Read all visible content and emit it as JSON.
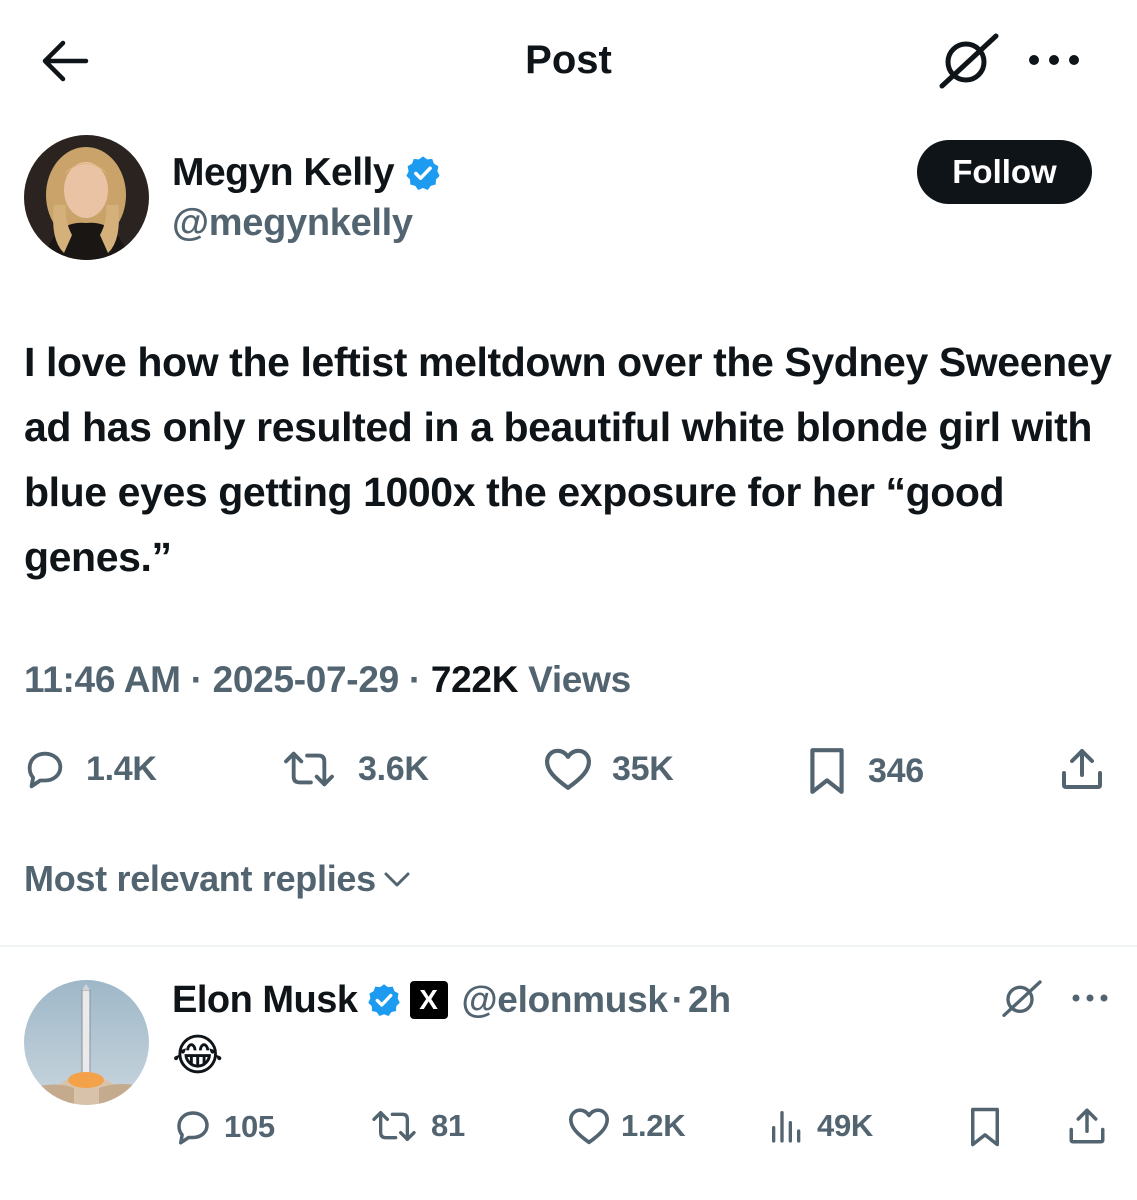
{
  "header": {
    "title": "Post",
    "icons": {
      "back": "arrow-left-icon",
      "grok": "grok-icon",
      "more": "more-horizontal-icon"
    }
  },
  "post": {
    "author": {
      "name": "Megyn Kelly",
      "handle": "@megynkelly",
      "verified_badge_color": "#1d9bf0"
    },
    "follow_label": "Follow",
    "text": "I love how the leftist meltdown over the Sydney Sweeney ad has only resulted in a beautiful white blonde girl with blue eyes getting 1000x the exposure for her “good genes.”",
    "meta": {
      "time": "11:46 AM",
      "sep1": " · ",
      "date": "2025-07-29",
      "sep2": " · ",
      "views_count": "722K",
      "views_label": " Views"
    },
    "actions": {
      "replies": "1.4K",
      "reposts": "3.6K",
      "likes": "35K",
      "bookmarks": "346"
    }
  },
  "replies_sort": {
    "label": "Most relevant replies"
  },
  "reply": {
    "author": {
      "name": "Elon Musk",
      "affiliate": "X",
      "handle": "@elonmusk",
      "sep": "·",
      "time": "2h"
    },
    "text": "😂",
    "actions": {
      "replies": "105",
      "reposts": "81",
      "likes": "1.2K",
      "views": "49K"
    }
  },
  "colors": {
    "text_primary": "#0f1419",
    "text_secondary": "#536471",
    "accent": "#1d9bf0",
    "divider": "#eff3f4"
  }
}
